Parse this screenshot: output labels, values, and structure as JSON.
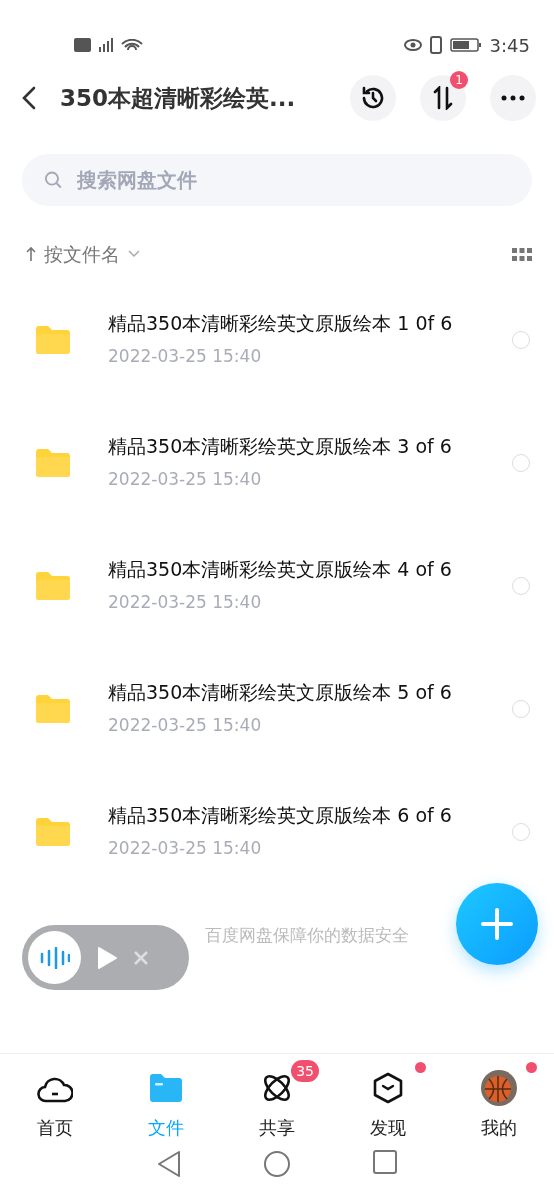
{
  "status_bar": {
    "time": "3:45"
  },
  "header": {
    "title": "350本超清晰彩绘英...",
    "transfer_badge": "1"
  },
  "search": {
    "placeholder": "搜索网盘文件"
  },
  "sort": {
    "label": "按文件名"
  },
  "files": [
    {
      "name": "精品350本清晰彩绘英文原版绘本 1 0f 6",
      "date": "2022-03-25  15:40",
      "selected": false
    },
    {
      "name": "精品350本清晰彩绘英文原版绘本 3 of 6",
      "date": "2022-03-25  15:40",
      "selected": false
    },
    {
      "name": "精品350本清晰彩绘英文原版绘本 4 of 6",
      "date": "2022-03-25  15:40",
      "selected": false
    },
    {
      "name": "精品350本清晰彩绘英文原版绘本 5 of 6",
      "date": "2022-03-25  15:40",
      "selected": false
    },
    {
      "name": "精品350本清晰彩绘英文原版绘本 6 of 6",
      "date": "2022-03-25  15:40",
      "selected": false
    }
  ],
  "footer_note": "百度网盘保障你的数据安全",
  "tabs": [
    {
      "kind": "home",
      "label": "首页",
      "selected": false
    },
    {
      "kind": "files",
      "label": "文件",
      "selected": true
    },
    {
      "kind": "share",
      "label": "共享",
      "selected": false,
      "badge": "35"
    },
    {
      "kind": "discover",
      "label": "发现",
      "selected": false,
      "dot": true
    },
    {
      "kind": "me",
      "label": "我的",
      "selected": false,
      "dot": true
    }
  ]
}
